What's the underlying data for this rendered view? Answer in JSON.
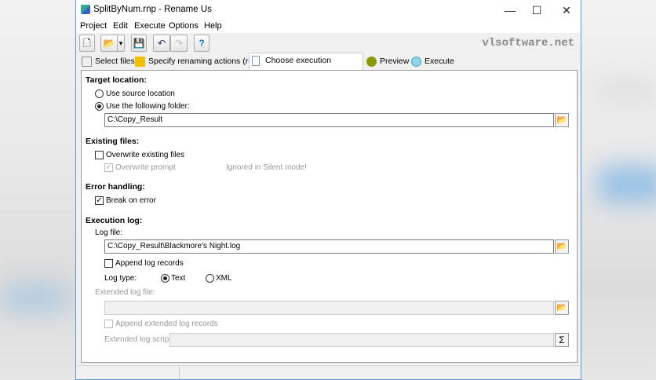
{
  "window": {
    "title": "SplitByNum.rnp - Rename Us",
    "minimize": "—",
    "maximize": "☐",
    "close": "✕"
  },
  "menu": [
    "Project",
    "Edit",
    "Execute",
    "Options",
    "Help"
  ],
  "toolbar": {
    "new": "🗋",
    "open": "📂",
    "dropdown": "▾",
    "save": "💾",
    "undo": "↶",
    "redo": "↷",
    "help": "?"
  },
  "brand": "vlsoftware.net",
  "tabs": [
    {
      "label": "Select files",
      "color": "#9aa"
    },
    {
      "label": "Specify renaming actions (rules)",
      "color": "#d9a400"
    },
    {
      "label": "Choose execution parameters",
      "color": "#7a9ab8"
    },
    {
      "label": "Preview",
      "color": "#8a9a00"
    },
    {
      "label": "Execute",
      "color": "#3fa9c9"
    }
  ],
  "target": {
    "heading": "Target location:",
    "opt_source": "Use source location",
    "opt_folder": "Use the following folder:",
    "folder": "C:\\Copy_Result"
  },
  "existing": {
    "heading": "Existing files:",
    "overwrite": "Overwrite existing files",
    "prompt": "Overwrite prompt",
    "note": "Ignored in Silent mode!"
  },
  "error": {
    "heading": "Error handling:",
    "break": "Break on error"
  },
  "log": {
    "heading": "Execution log:",
    "file_label": "Log file:",
    "file": "C:\\Copy_Result\\Blackmore's Night.log",
    "append": "Append log records",
    "type_label": "Log type:",
    "type_text": "Text",
    "type_xml": "XML",
    "ext_label": "Extended log file:",
    "ext_file": "",
    "ext_append": "Append extended log records",
    "script_label": "Extended log script:",
    "script": "",
    "sigma": "Σ"
  }
}
